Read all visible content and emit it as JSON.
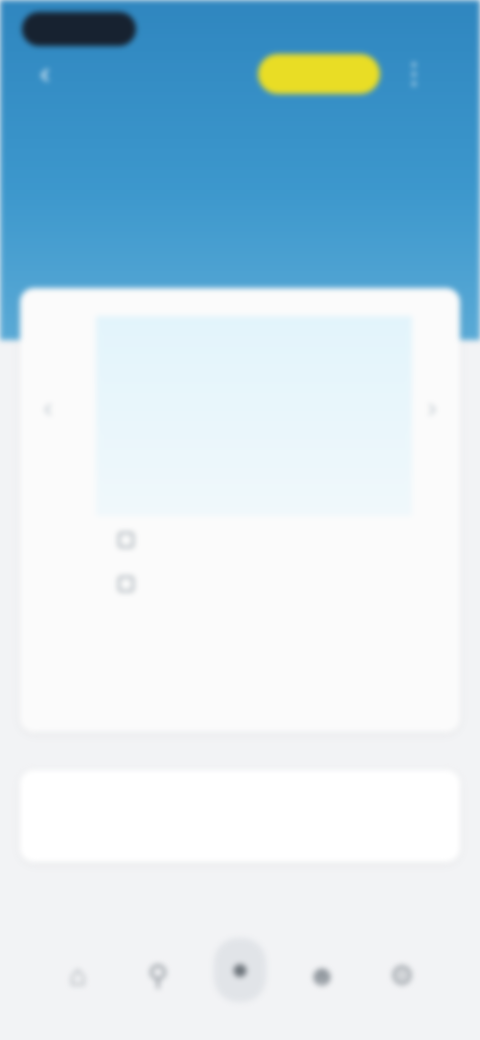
{
  "status": {
    "time": "",
    "right": ""
  },
  "header": {
    "back_icon": "back-arrow-icon",
    "vip_label": "",
    "menu_icon": "more-icon",
    "subtitle": "",
    "center_label": ""
  },
  "panel": {
    "left_arrow_icon": "chevron-left-icon",
    "right_arrow_icon": "chevron-right-icon",
    "options": [
      "",
      "",
      "",
      ""
    ]
  },
  "items": [
    "",
    ""
  ],
  "summary": "",
  "action": {
    "label": ""
  },
  "bottom_nav": {
    "icons": [
      "home-icon",
      "search-icon",
      "center-action-icon",
      "profile-icon",
      "settings-icon"
    ]
  },
  "colors": {
    "header": "#3c97cc",
    "vip": "#e9dd25",
    "card": "#fbfbfb",
    "background": "#f2f3f5"
  }
}
